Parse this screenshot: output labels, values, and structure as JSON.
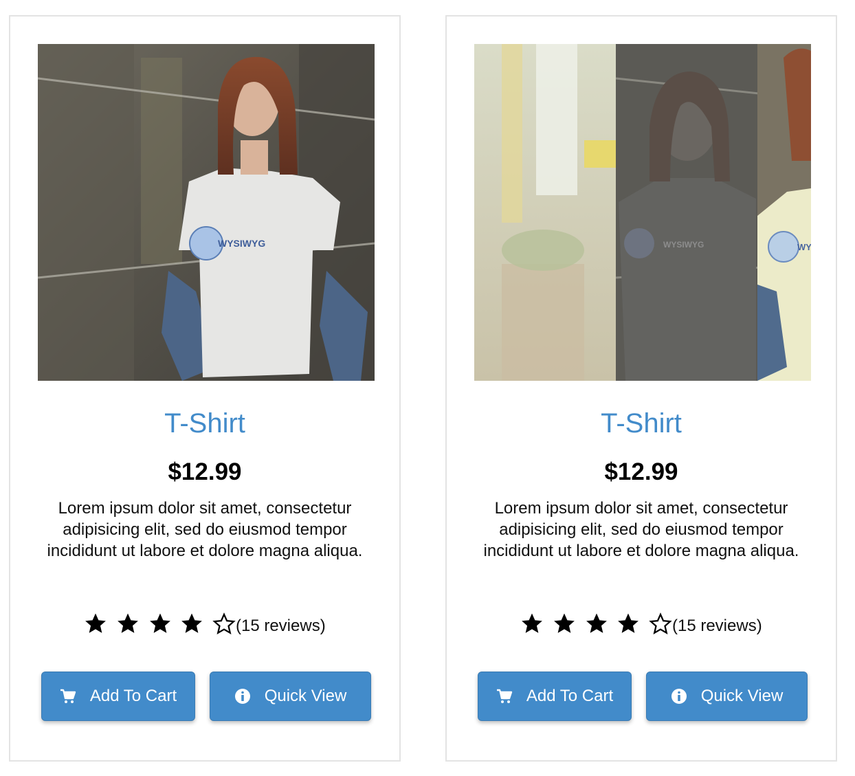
{
  "theme": {
    "accent": "#428bca",
    "title_color": "#428bca",
    "card_border": "#e3e3e3"
  },
  "products": [
    {
      "image_alt": "Woman wearing white WYSIWYG t-shirt",
      "title": "T-Shirt",
      "price": "$12.99",
      "description": "Lorem ipsum dolor sit amet, consectetur adipisicing elit, sed do eiusmod tempor incididunt ut labore et dolore magna aliqua.",
      "rating": 4,
      "rating_max": 5,
      "reviews": "(15 reviews)",
      "add_to_cart_label": "Add To Cart",
      "add_to_cart_icon": "shopping-cart-icon",
      "quick_view_label": "Quick View",
      "quick_view_icon": "info-circle-icon"
    },
    {
      "image_alt": "Hover state image transition of t-shirt product",
      "title": "T-Shirt",
      "price": "$12.99",
      "description": "Lorem ipsum dolor sit amet, consectetur adipisicing elit, sed do eiusmod tempor incididunt ut labore et dolore magna aliqua.",
      "rating": 4,
      "rating_max": 5,
      "reviews": "(15 reviews)",
      "add_to_cart_label": "Add To Cart",
      "add_to_cart_icon": "shopping-cart-icon",
      "quick_view_label": "Quick View",
      "quick_view_icon": "info-circle-icon"
    }
  ]
}
